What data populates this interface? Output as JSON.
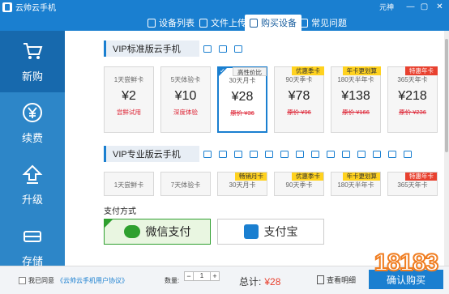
{
  "window": {
    "title": "云帅云手机",
    "user": "元神",
    "controls": [
      "—",
      "▢",
      "✕"
    ]
  },
  "tabs": [
    {
      "label": "设备列表",
      "icon": "phone-icon"
    },
    {
      "label": "文件上传",
      "icon": "upload-icon"
    },
    {
      "label": "购买设备",
      "icon": "cart-icon"
    },
    {
      "label": "常见问题",
      "icon": "question-icon"
    }
  ],
  "active_tab": "购买设备",
  "sidebar": {
    "items": [
      {
        "label": "新购",
        "icon": "cart-icon"
      },
      {
        "label": "续费",
        "icon": "yen-icon"
      },
      {
        "label": "升级",
        "icon": "up-arrow-icon"
      },
      {
        "label": "存储",
        "icon": "storage-icon"
      }
    ]
  },
  "vip_standard": {
    "title": "VIP标准版云手机",
    "cards": [
      {
        "name": "1天尝鲜卡",
        "price": "¥2",
        "sub": "尝鲜试用",
        "tag": ""
      },
      {
        "name": "5天体验卡",
        "price": "¥10",
        "sub": "深度体验",
        "tag": ""
      },
      {
        "name": "30天月卡",
        "price": "¥28",
        "sub": "原价 ¥36",
        "tag": "高性价比"
      },
      {
        "name": "90天季卡",
        "price": "¥78",
        "sub": "原价 ¥96",
        "tag": "优惠季卡"
      },
      {
        "name": "180天半年卡",
        "price": "¥138",
        "sub": "原价 ¥166",
        "tag": "年卡更划算"
      },
      {
        "name": "365天年卡",
        "price": "¥218",
        "sub": "原价 ¥236",
        "tag": "特惠年卡"
      }
    ]
  },
  "vip_pro": {
    "title": "VIP专业版云手机",
    "cards": [
      {
        "name": "1天尝鲜卡",
        "tag": ""
      },
      {
        "name": "7天体验卡",
        "tag": ""
      },
      {
        "name": "30天月卡",
        "tag": "畅销月卡"
      },
      {
        "name": "90天季卡",
        "tag": "优惠季卡"
      },
      {
        "name": "180天半年卡",
        "tag": "年卡更划算"
      },
      {
        "name": "365天年卡",
        "tag": "特惠年卡"
      }
    ]
  },
  "payment": {
    "label": "支付方式",
    "wechat": "微信支付",
    "alipay": "支付宝"
  },
  "bottom": {
    "agree": "我已同意",
    "agreement_link": "《云帅云手机用户协议》",
    "qty_label": "数量:",
    "qty_minus": "−",
    "qty_value": "1",
    "qty_plus": "+",
    "total_label": "总计:",
    "total_amount": "¥28",
    "detail_label": "查看明细",
    "confirm_label": "确认购买",
    "watermark": "18183"
  }
}
